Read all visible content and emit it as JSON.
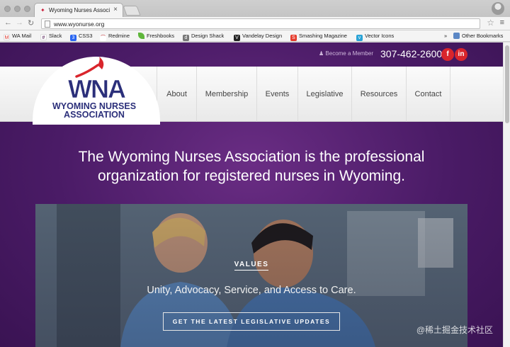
{
  "browser": {
    "tab_title": "Wyoming Nurses Associatio",
    "url": "www.wyonurse.org",
    "bookmarks": [
      {
        "label": "WA Mail",
        "color": "#d93025",
        "glyph": "M"
      },
      {
        "label": "Slack",
        "color": "#4a154b",
        "glyph": "#"
      },
      {
        "label": "CSS3",
        "color": "#2965f1",
        "glyph": "3"
      },
      {
        "label": "Redmine",
        "color": "#b32024",
        "glyph": "R"
      },
      {
        "label": "Freshbooks",
        "color": "#5fb63b",
        "glyph": "f"
      },
      {
        "label": "Design Shack",
        "color": "#777777",
        "glyph": "d"
      },
      {
        "label": "Vandelay Design",
        "color": "#222222",
        "glyph": "V"
      },
      {
        "label": "Smashing Magazine",
        "color": "#e53b2c",
        "glyph": "S"
      },
      {
        "label": "Vector Icons",
        "color": "#2aa3d6",
        "glyph": "v"
      }
    ],
    "other_bookmarks": "Other Bookmarks",
    "overflow": "»"
  },
  "site": {
    "become_member": "Become a Member",
    "phone": "307-462-2600",
    "social": [
      {
        "name": "facebook-icon",
        "glyph": "f"
      },
      {
        "name": "linkedin-icon",
        "glyph": "in"
      }
    ],
    "logo": {
      "abbr": "WNA",
      "line1": "WYOMING NURSES",
      "line2": "ASSOCIATION"
    },
    "nav": [
      "About",
      "Membership",
      "Events",
      "Legislative",
      "Resources",
      "Contact"
    ],
    "headline_line1": "The Wyoming Nurses Association is the professional",
    "headline_line2": "organization for registered nurses in Wyoming.",
    "hero": {
      "section_label": "VALUES",
      "tagline": "Unity, Advocacy, Service, and Access to Care.",
      "cta": "GET THE LATEST LEGISLATIVE UPDATES"
    },
    "watermark": "@稀土掘金技术社区"
  },
  "colors": {
    "brand_purple": "#4a1b66",
    "logo_navy": "#2b2f7a",
    "accent_red": "#d9252c"
  }
}
